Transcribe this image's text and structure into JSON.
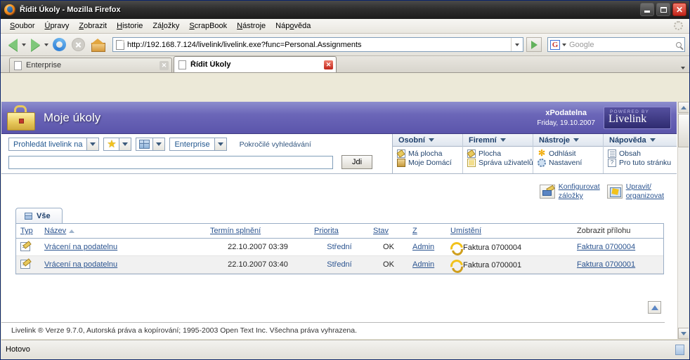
{
  "browser": {
    "window_title": "Řídit Úkoly - Mozilla Firefox",
    "menu": [
      "Soubor",
      "Úpravy",
      "Zobrazit",
      "Historie",
      "Záložky",
      "ScrapBook",
      "Nástroje",
      "Nápověda"
    ],
    "url": "http://192.168.7.124/livelink/livelink.exe?func=Personal.Assignments",
    "search_placeholder": "Google",
    "search_engine_letter": "G",
    "tabs": [
      {
        "label": "Enterprise",
        "active": false
      },
      {
        "label": "Řídit Úkoly",
        "active": true
      }
    ],
    "status_text": "Hotovo"
  },
  "livelink": {
    "banner_title": "Moje úkoly",
    "site_name": "xPodatelna",
    "site_date": "Friday, 19.10.2007",
    "logo_powered": "POWERED BY",
    "logo_name": "Livelink",
    "toolbar": {
      "scope_label": "Prohledát livelink na",
      "slice_label": "Enterprise",
      "advanced_search": "Pokročilé vyhledávání",
      "search_value": "",
      "go_label": "Jdi"
    },
    "menus": [
      {
        "title": "Osobní",
        "items": [
          {
            "label": "Má plocha",
            "icon": "desktop-doc-icon"
          },
          {
            "label": "Moje Domácí",
            "icon": "home-icon"
          }
        ]
      },
      {
        "title": "Firemní",
        "items": [
          {
            "label": "Plocha",
            "icon": "desktop-doc-icon"
          },
          {
            "label": "Správa uživatelů",
            "icon": "user-admin-icon"
          }
        ]
      },
      {
        "title": "Nástroje",
        "items": [
          {
            "label": "Odhlásit",
            "icon": "logout-icon"
          },
          {
            "label": "Nastavení",
            "icon": "settings-gear-icon"
          }
        ]
      },
      {
        "title": "Nápověda",
        "items": [
          {
            "label": "Obsah",
            "icon": "book-icon"
          },
          {
            "label": "Pro tuto stránku",
            "icon": "help-page-icon"
          }
        ]
      }
    ],
    "actions": [
      {
        "line1": "Konfigurovat",
        "line2": "záložky",
        "icon": "configure-bookmarks-icon"
      },
      {
        "line1": "Upravit/",
        "line2": "organizovat",
        "icon": "edit-organize-icon"
      }
    ],
    "tab_label": "Vše",
    "table": {
      "columns": [
        {
          "label": "Typ",
          "link": true
        },
        {
          "label": "Název",
          "link": true,
          "sort": "asc"
        },
        {
          "label": "Termín splnění",
          "link": true
        },
        {
          "label": "Priorita",
          "link": true
        },
        {
          "label": "Stav",
          "link": true
        },
        {
          "label": "Z",
          "link": true
        },
        {
          "label": "Umístění",
          "link": true
        },
        {
          "label": "Zobrazit přílohu",
          "link": false
        }
      ],
      "rows": [
        {
          "name": "Vrácení na podatelnu",
          "due": "22.10.2007 03:39",
          "priority": "Střední",
          "status": "OK",
          "from": "Admin",
          "location": "Faktura 0700004",
          "attachment": "Faktura 0700004"
        },
        {
          "name": "Vrácení na podatelnu",
          "due": "22.10.2007 03:40",
          "priority": "Střední",
          "status": "OK",
          "from": "Admin",
          "location": "Faktura 0700001",
          "attachment": "Faktura 0700001"
        }
      ]
    },
    "footer": "Livelink ® Verze 9.7.0, Autorská práva a kopírování; 1995-2003 Open Text Inc. Všechna práva vyhrazena."
  },
  "colors": {
    "banner_purple": "#6b66b8",
    "link_blue": "#2b5490",
    "header_navy": "#1d3f6b",
    "accent_gold": "#e8c95c"
  }
}
